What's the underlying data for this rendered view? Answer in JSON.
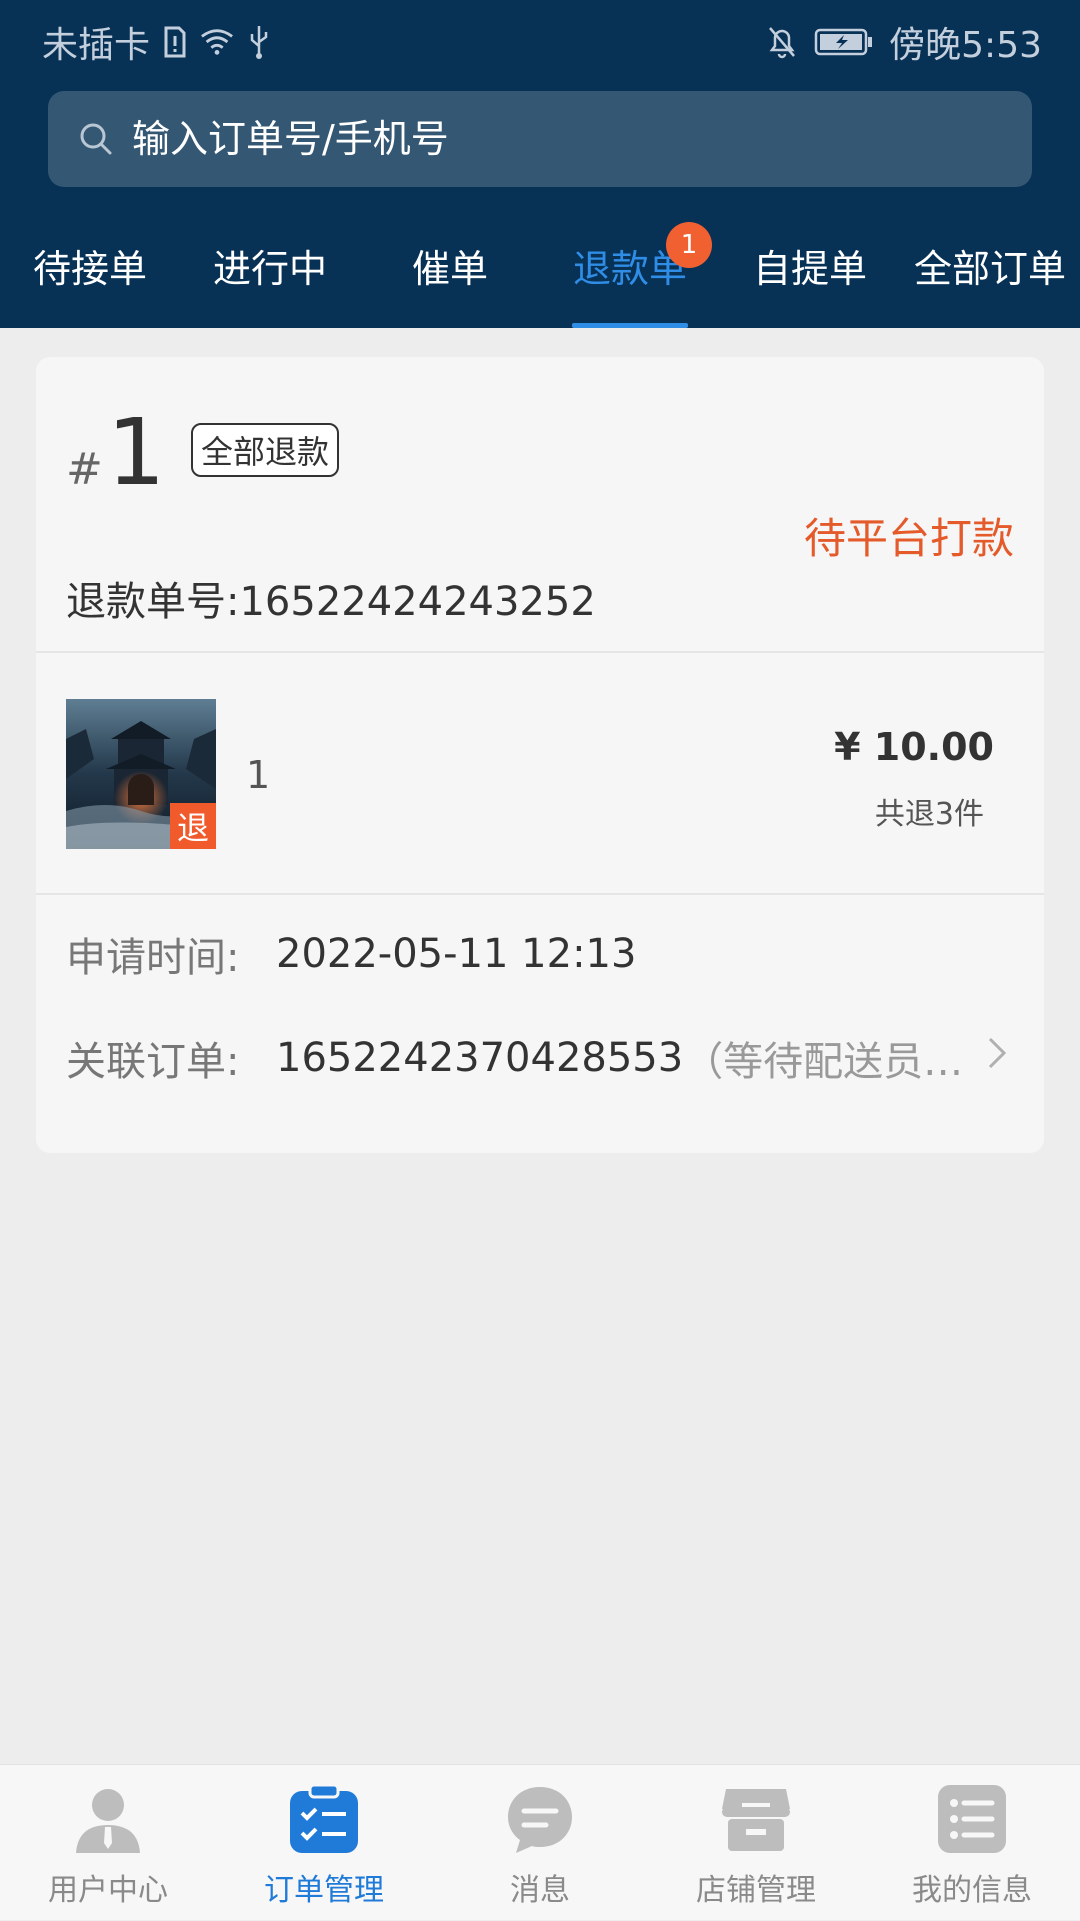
{
  "status_bar": {
    "carrier": "未插卡",
    "time": "傍晚5:53"
  },
  "search": {
    "placeholder": "输入订单号/手机号"
  },
  "tabs": [
    {
      "label": "待接单",
      "active": false
    },
    {
      "label": "进行中",
      "active": false
    },
    {
      "label": "催单",
      "active": false
    },
    {
      "label": "退款单",
      "active": true,
      "badge": "1"
    },
    {
      "label": "自提单",
      "active": false
    },
    {
      "label": "全部订单",
      "active": false
    }
  ],
  "refund_card": {
    "hash": "#",
    "order_index": "1",
    "refund_type": "全部退款",
    "status": "待平台打款",
    "refund_number": "退款单号:16522424243252",
    "product": {
      "name": "1",
      "tag": "退",
      "price": "¥ 10.00",
      "quantity_text": "共退3件"
    },
    "apply_time_label": "申请时间:",
    "apply_time": "2022-05-11 12:13",
    "related_order_label": "关联订单:",
    "related_order": "1652242370428553",
    "related_order_note": "（等待配送员…"
  },
  "colors": {
    "header_bg": "#073155",
    "accent_blue": "#2f8de6",
    "status_orange": "#e55a2a",
    "badge_red": "#f06031"
  },
  "bottom_nav": [
    {
      "label": "用户中心",
      "icon": "user-icon",
      "active": false
    },
    {
      "label": "订单管理",
      "icon": "order-checklist-icon",
      "active": true
    },
    {
      "label": "消息",
      "icon": "message-icon",
      "active": false
    },
    {
      "label": "店铺管理",
      "icon": "store-icon",
      "active": false
    },
    {
      "label": "我的信息",
      "icon": "list-icon",
      "active": false
    }
  ]
}
